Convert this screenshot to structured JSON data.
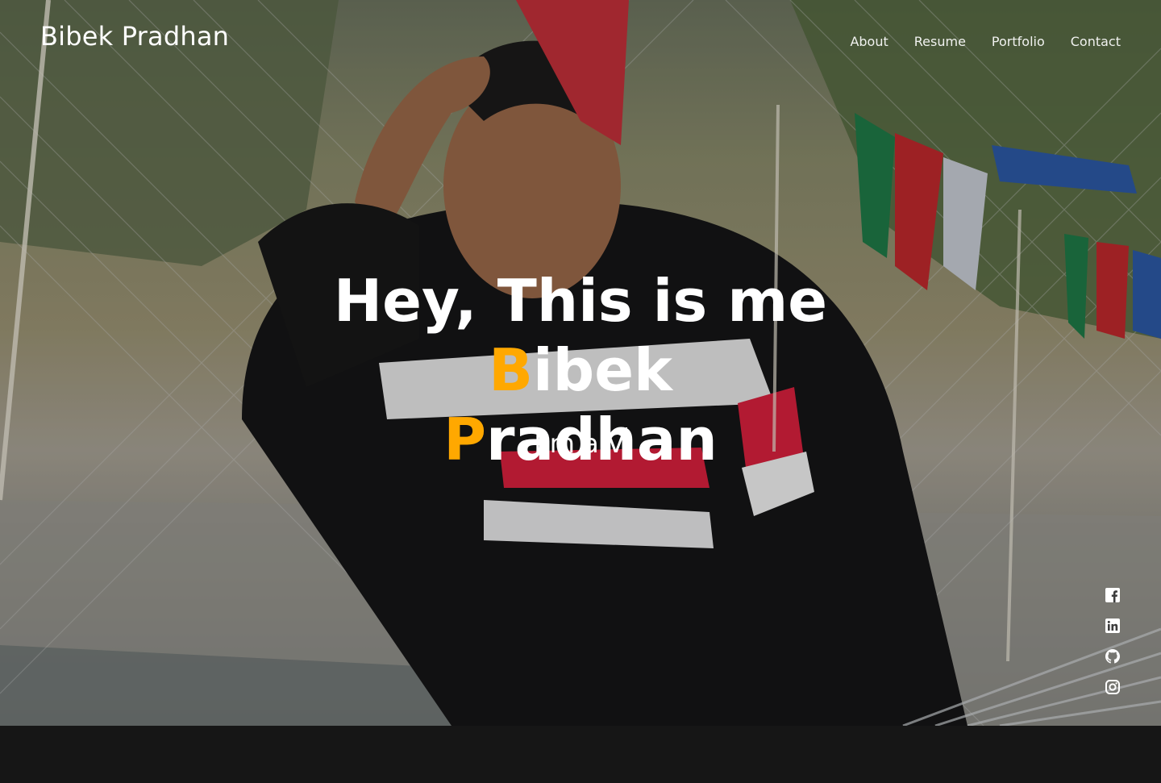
{
  "header": {
    "logo": "Bibek Pradhan",
    "nav": [
      {
        "label": "About"
      },
      {
        "label": "Resume"
      },
      {
        "label": "Portfolio"
      },
      {
        "label": "Contact"
      }
    ]
  },
  "hero": {
    "headline_prefix": "Hey, This is me ",
    "first_initial": "B",
    "first_rest": "ibek",
    "last_initial": "P",
    "last_rest": "radhan",
    "typed_text": "I’m a V"
  },
  "social": [
    "facebook-icon",
    "linkedin-icon",
    "github-icon",
    "instagram-icon"
  ],
  "colors": {
    "accent": "#ffa800",
    "text": "#ffffff",
    "footer_bg": "#161616"
  }
}
